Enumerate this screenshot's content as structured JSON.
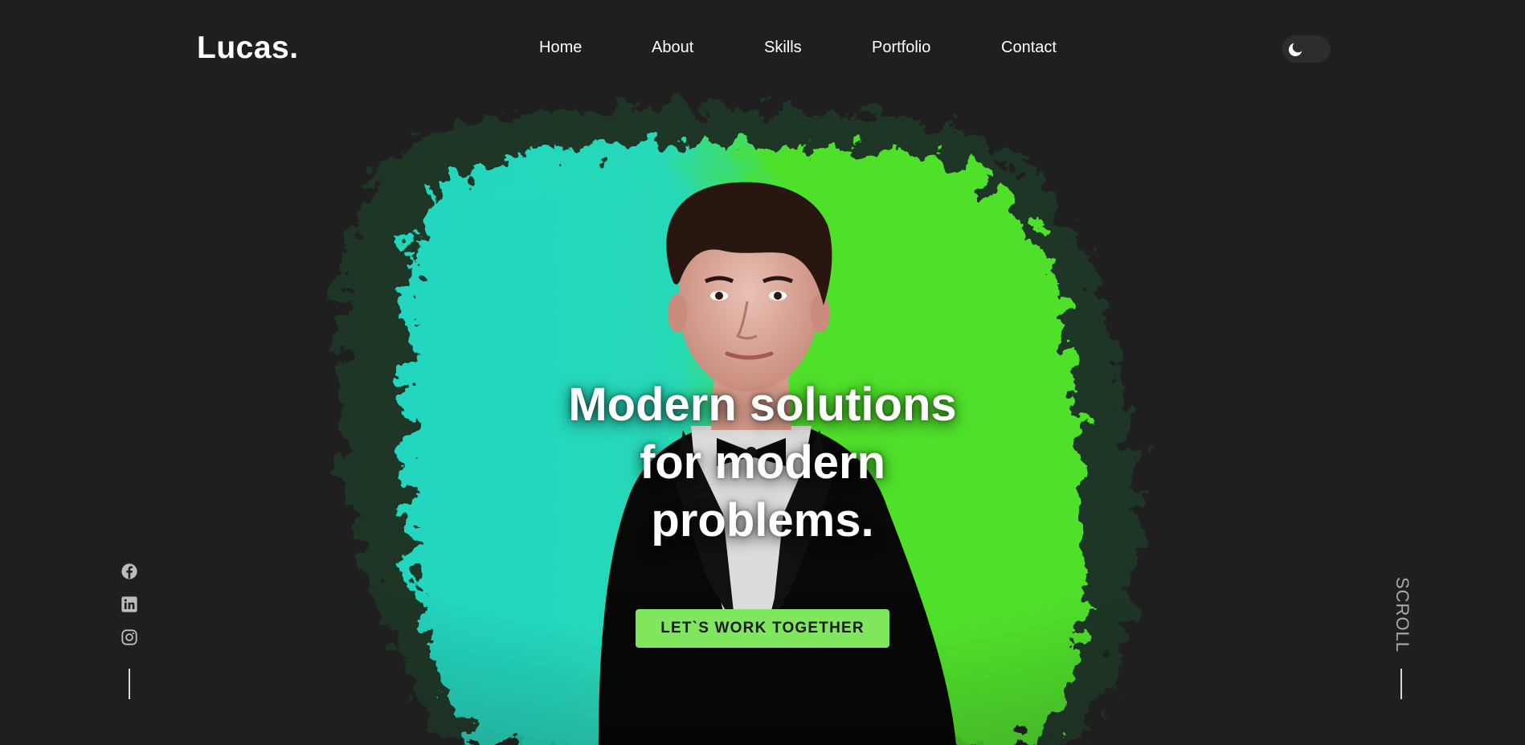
{
  "brand": {
    "logo": "Lucas."
  },
  "nav": {
    "items": [
      {
        "label": "Home"
      },
      {
        "label": "About"
      },
      {
        "label": "Skills"
      },
      {
        "label": "Portfolio"
      },
      {
        "label": "Contact"
      }
    ]
  },
  "theme_toggle": {
    "icon": "moon-icon",
    "state": "dark"
  },
  "hero": {
    "title_line1": "Modern solutions",
    "title_line2": "for modern",
    "title_line3": "problems.",
    "cta_label": "LET`S WORK TOGETHER",
    "image": "portrait-photo"
  },
  "social": {
    "icons": [
      "facebook-icon",
      "linkedin-icon",
      "instagram-icon"
    ]
  },
  "scroll": {
    "label": "SCROLL"
  },
  "colors": {
    "background": "#1f1f1f",
    "accent": "#7fe65e",
    "splash_green": "#4fe02c",
    "splash_teal": "#22d6c0",
    "text": "#ffffff",
    "muted": "#a9a9a9"
  }
}
